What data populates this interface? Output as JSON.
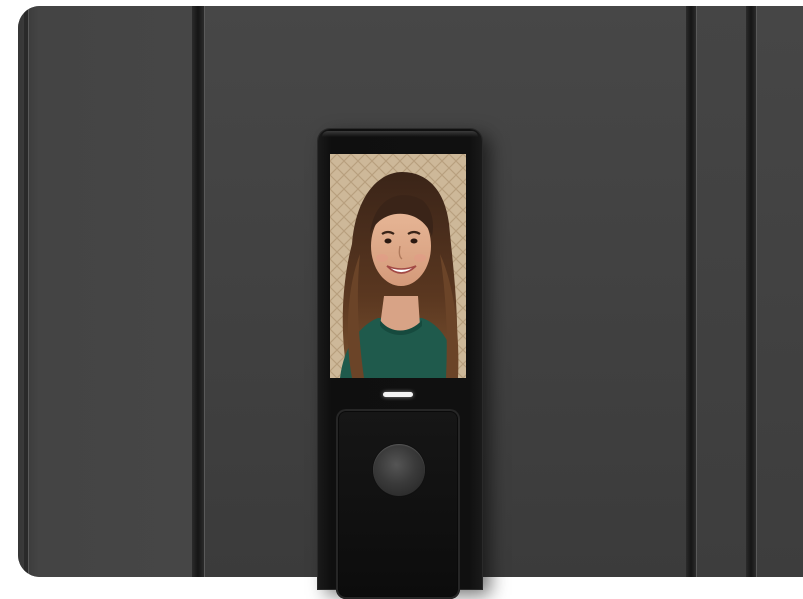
{
  "scene": {
    "subject": "smart-door-lock",
    "colors": {
      "door": "#444444",
      "lock_body": "#101010",
      "indicator": "#f4f4f4"
    },
    "screen": {
      "content": "portrait-photo"
    },
    "icons": [
      "fingerprint-sensor-icon"
    ]
  }
}
